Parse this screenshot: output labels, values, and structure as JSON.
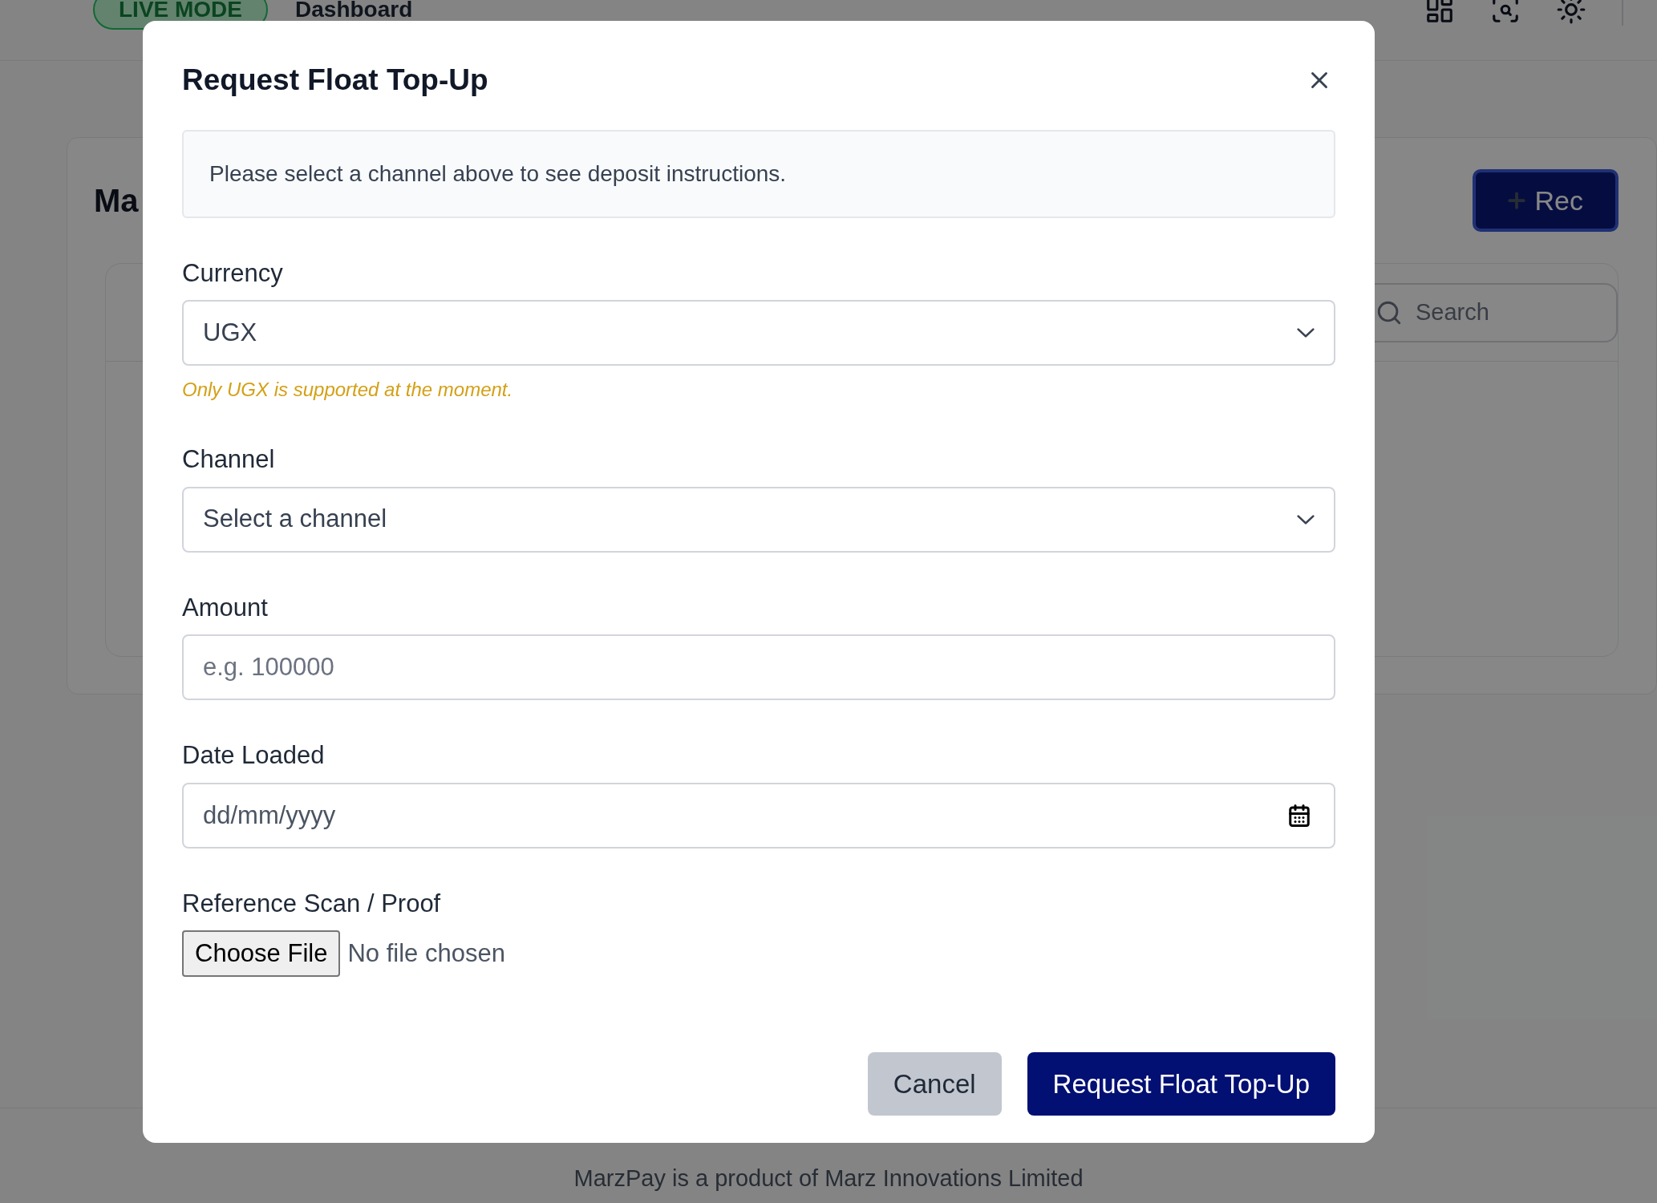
{
  "header": {
    "mode_badge": "LIVE MODE",
    "title": "Dashboard"
  },
  "page": {
    "heading": "Ma",
    "action_button": "Rec",
    "search": {
      "placeholder": "Search"
    }
  },
  "footer": {
    "lines": [
      "MarzPay is a product of Marz Innovations Limited"
    ]
  },
  "modal": {
    "title": "Request Float Top-Up",
    "notice": "Please select a channel above to see deposit instructions.",
    "fields": [
      {
        "kind": "select",
        "label": "Currency",
        "value": "UGX",
        "hint": "Only UGX is supported at the moment."
      },
      {
        "kind": "select",
        "label": "Channel",
        "placeholder": "Select a channel"
      },
      {
        "kind": "text",
        "label": "Amount",
        "placeholder": "e.g. 100000"
      },
      {
        "kind": "date",
        "label": "Date Loaded",
        "placeholder": "dd/mm/yyyy"
      },
      {
        "kind": "file",
        "label": "Reference Scan / Proof",
        "button": "Choose File",
        "status": "No file chosen"
      }
    ],
    "buttons": [
      {
        "kind": "secondary",
        "label": "Cancel"
      },
      {
        "kind": "primary",
        "label": "Request Float Top-Up"
      }
    ]
  }
}
